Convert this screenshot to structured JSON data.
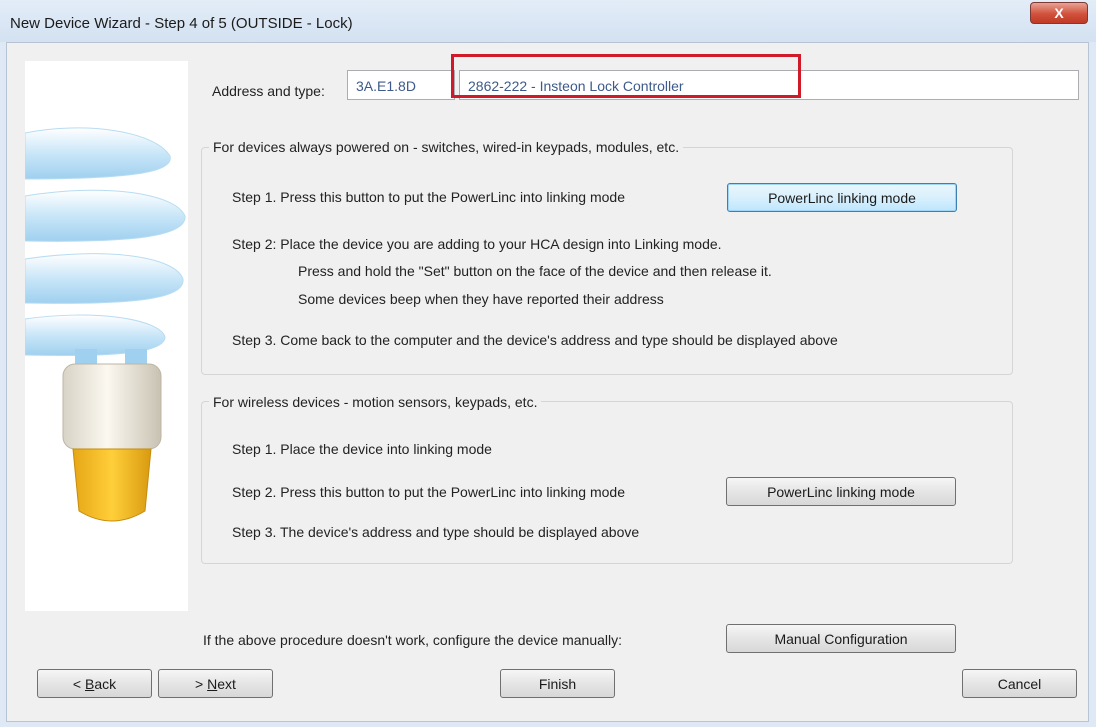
{
  "window": {
    "title": "New Device Wizard - Step 4 of 5 (OUTSIDE - Lock)",
    "close_label": "X"
  },
  "address": {
    "label": "Address and type:",
    "value": "3A.E1.8D",
    "type_value": "2862-222 - Insteon Lock Controller"
  },
  "powered_group": {
    "title": "For devices always powered on - switches, wired-in keypads, modules, etc.",
    "step1": "Step 1. Press this button to put the PowerLinc into linking mode",
    "button": "PowerLinc linking mode",
    "step2": "Step 2:  Place the device you are adding to your HCA design into Linking mode.",
    "step2_detail1": "Press and hold the \"Set\" button on the face of the device and then release it.",
    "step2_detail2": "Some devices beep when they have reported their address",
    "step3": "Step 3. Come back to the computer and the device's address and type should be displayed above"
  },
  "wireless_group": {
    "title": "For wireless devices - motion sensors, keypads, etc.",
    "step1": "Step 1. Place the device into linking mode",
    "step2": "Step 2. Press this button to put the PowerLinc into linking mode",
    "button": "PowerLinc linking mode",
    "step3": "Step 3. The device's address and type should be displayed above"
  },
  "manual": {
    "text": "If the above procedure doesn't work, configure the device manually:",
    "button": "Manual Configuration"
  },
  "nav": {
    "back_prefix": "< ",
    "back_key": "B",
    "back_rest": "ack",
    "next_prefix": "> ",
    "next_key": "N",
    "next_rest": "ext",
    "finish": "Finish",
    "cancel": "Cancel"
  }
}
